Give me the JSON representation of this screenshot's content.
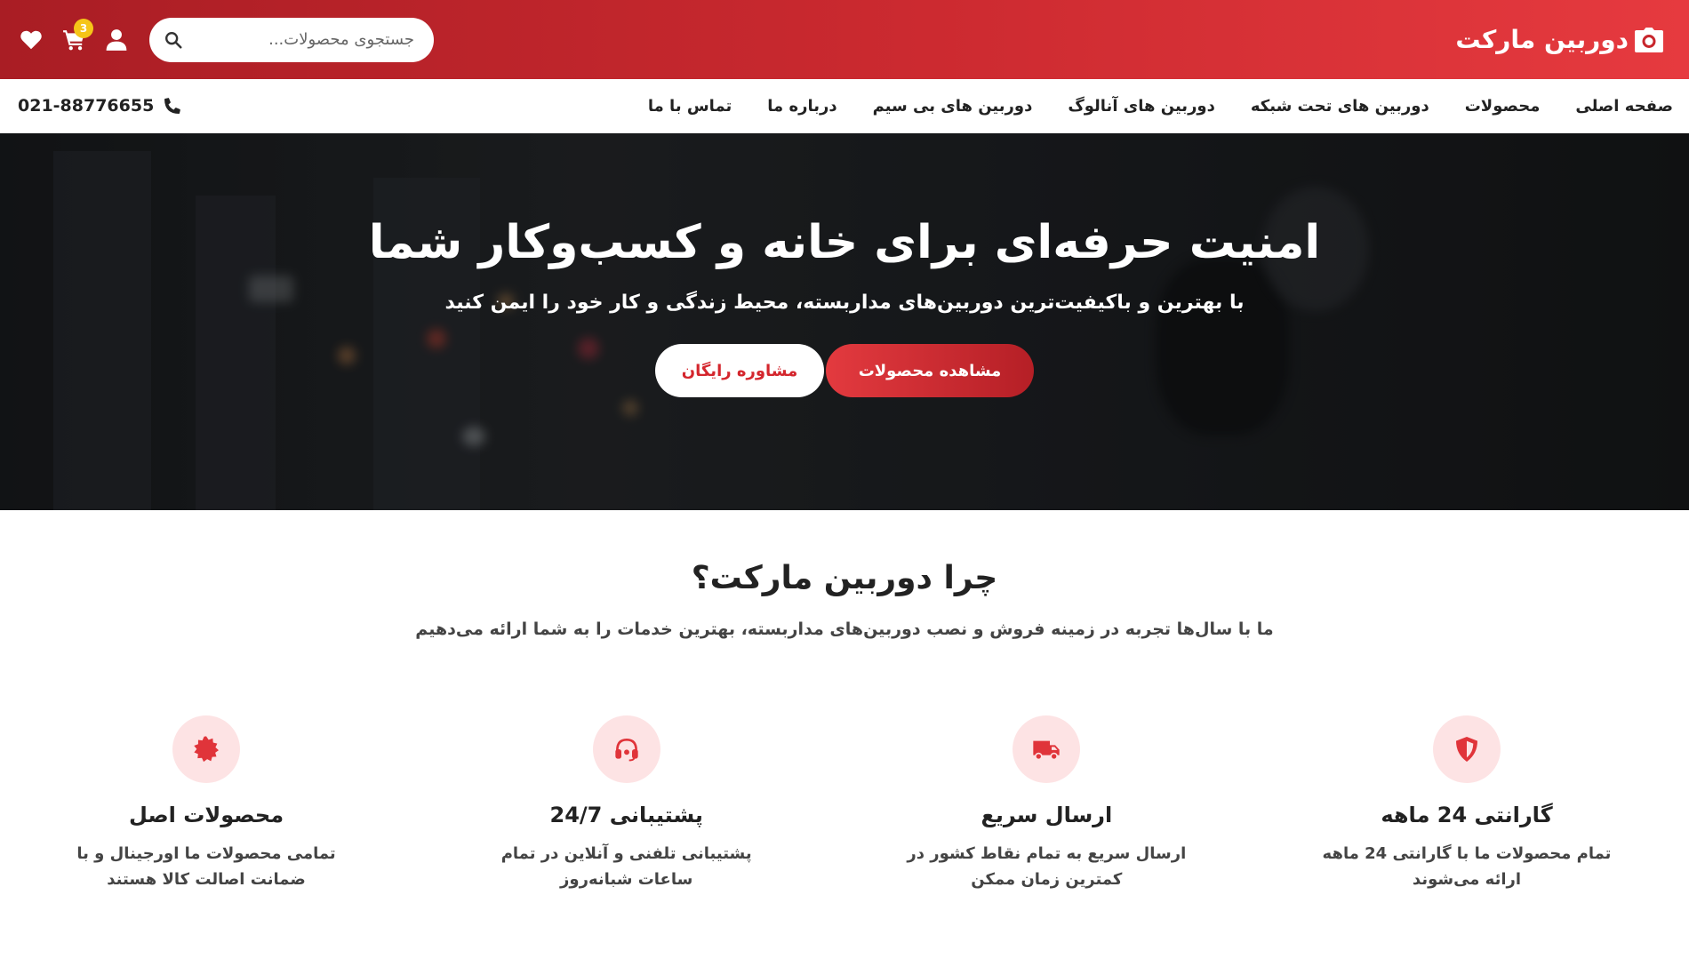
{
  "header": {
    "brand": "دوربین مارکت",
    "search_placeholder": "جستجوی محصولات...",
    "cart_count": "3"
  },
  "nav": {
    "items": [
      {
        "label": "صفحه اصلی"
      },
      {
        "label": "محصولات"
      },
      {
        "label": "دوربین های تحت شبکه"
      },
      {
        "label": "دوربین های آنالوگ"
      },
      {
        "label": "دوربین های بی سیم"
      },
      {
        "label": "درباره ما"
      },
      {
        "label": "تماس با ما"
      }
    ],
    "phone": "021-88776655"
  },
  "hero": {
    "title": "امنیت حرفه‌ای برای خانه و کسب‌وکار شما",
    "subtitle": "با بهترین و باکیفیت‌ترین دوربین‌های مداربسته، محیط زندگی و کار خود را ایمن کنید",
    "primary_button": "مشاهده محصولات",
    "secondary_button": "مشاوره رایگان"
  },
  "why": {
    "title": "چرا دوربین مارکت؟",
    "subtitle": "ما با سال‌ها تجربه در زمینه فروش و نصب دوربین‌های مداربسته، بهترین خدمات را به شما ارائه می‌دهیم",
    "features": [
      {
        "icon": "shield-icon",
        "title": "گارانتی 24 ماهه",
        "desc": "تمام محصولات ما با گارانتی 24 ماهه ارائه می‌شوند"
      },
      {
        "icon": "truck-icon",
        "title": "ارسال سریع",
        "desc": "ارسال سریع به تمام نقاط کشور در کمترین زمان ممکن"
      },
      {
        "icon": "headset-icon",
        "title": "پشتیبانی 24/7",
        "desc": "پشتیبانی تلفنی و آنلاین در تمام ساعات شبانه‌روز"
      },
      {
        "icon": "certificate-icon",
        "title": "محصولات اصل",
        "desc": "تمامی محصولات ما اورجینال و با ضمانت اصالت کالا هستند"
      }
    ]
  },
  "colors": {
    "brand_red": "#d4262d",
    "icon_bg": "#fde3e4",
    "badge_yellow": "#f5c518"
  }
}
